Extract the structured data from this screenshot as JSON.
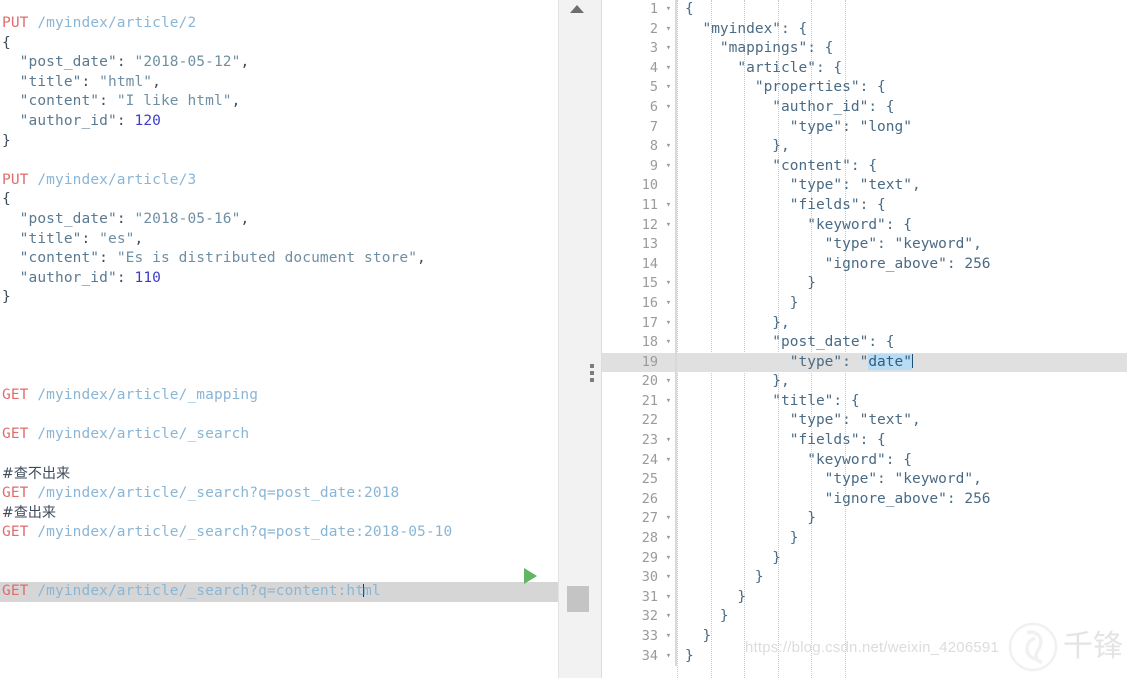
{
  "left_editor": {
    "name": "rest-request-editor",
    "lines": [
      {
        "type": "request",
        "verb": "PUT",
        "uri": "/myindex/article/2"
      },
      {
        "type": "plain",
        "text": "{"
      },
      {
        "type": "kv",
        "indent": 1,
        "key": "\"post_date\"",
        "value": "\"2018-05-12\"",
        "kind": "string",
        "comma": true
      },
      {
        "type": "kv",
        "indent": 1,
        "key": "\"title\"",
        "value": "\"html\"",
        "kind": "string",
        "comma": true
      },
      {
        "type": "kv",
        "indent": 1,
        "key": "\"content\"",
        "value": "\"I like html\"",
        "kind": "string",
        "comma": true
      },
      {
        "type": "kv",
        "indent": 1,
        "key": "\"author_id\"",
        "value": "120",
        "kind": "number",
        "comma": false
      },
      {
        "type": "plain",
        "text": "}"
      },
      {
        "type": "blank"
      },
      {
        "type": "request",
        "verb": "PUT",
        "uri": "/myindex/article/3"
      },
      {
        "type": "plain",
        "text": "{"
      },
      {
        "type": "kv",
        "indent": 1,
        "key": "\"post_date\"",
        "value": "\"2018-05-16\"",
        "kind": "string",
        "comma": true
      },
      {
        "type": "kv",
        "indent": 1,
        "key": "\"title\"",
        "value": "\"es\"",
        "kind": "string",
        "comma": true
      },
      {
        "type": "kv",
        "indent": 1,
        "key": "\"content\"",
        "value": "\"Es is distributed document store\"",
        "kind": "string",
        "comma": true
      },
      {
        "type": "kv",
        "indent": 1,
        "key": "\"author_id\"",
        "value": "110",
        "kind": "number",
        "comma": false
      },
      {
        "type": "plain",
        "text": "}"
      },
      {
        "type": "blank"
      },
      {
        "type": "blank"
      },
      {
        "type": "blank"
      },
      {
        "type": "blank"
      },
      {
        "type": "request",
        "verb": "GET",
        "uri": "/myindex/article/_mapping"
      },
      {
        "type": "blank"
      },
      {
        "type": "request",
        "verb": "GET",
        "uri": "/myindex/article/_search"
      },
      {
        "type": "blank"
      },
      {
        "type": "comment",
        "text": "#查不出来"
      },
      {
        "type": "request",
        "verb": "GET",
        "uri": "/myindex/article/_search?q=post_date:2018"
      },
      {
        "type": "comment",
        "text": "#查出来"
      },
      {
        "type": "request",
        "verb": "GET",
        "uri": "/myindex/article/_search?q=post_date:2018-05-10"
      },
      {
        "type": "blank"
      },
      {
        "type": "blank"
      },
      {
        "type": "request",
        "verb": "GET",
        "uri": "/myindex/article/_search?q=content:html",
        "active": true,
        "caret_after": "content:ht"
      }
    ],
    "run_button_label": "run-request",
    "wrench_button_label": "settings-wrench"
  },
  "splitter": {
    "scroll_up_label": "scroll-up",
    "handle_label": "pane-splitter"
  },
  "right_editor": {
    "name": "json-response-viewer",
    "current_line": 19,
    "selection_text": "date",
    "lines": [
      {
        "n": 1,
        "fold": true,
        "text": "{"
      },
      {
        "n": 2,
        "fold": true,
        "text": "  \"myindex\": {"
      },
      {
        "n": 3,
        "fold": true,
        "text": "    \"mappings\": {"
      },
      {
        "n": 4,
        "fold": true,
        "text": "      \"article\": {"
      },
      {
        "n": 5,
        "fold": true,
        "text": "        \"properties\": {"
      },
      {
        "n": 6,
        "fold": true,
        "text": "          \"author_id\": {"
      },
      {
        "n": 7,
        "fold": false,
        "text": "            \"type\": \"long\""
      },
      {
        "n": 8,
        "fold": true,
        "text": "          },"
      },
      {
        "n": 9,
        "fold": true,
        "text": "          \"content\": {"
      },
      {
        "n": 10,
        "fold": false,
        "text": "            \"type\": \"text\","
      },
      {
        "n": 11,
        "fold": true,
        "text": "            \"fields\": {"
      },
      {
        "n": 12,
        "fold": true,
        "text": "              \"keyword\": {"
      },
      {
        "n": 13,
        "fold": false,
        "text": "                \"type\": \"keyword\","
      },
      {
        "n": 14,
        "fold": false,
        "text": "                \"ignore_above\": 256"
      },
      {
        "n": 15,
        "fold": true,
        "text": "              }"
      },
      {
        "n": 16,
        "fold": true,
        "text": "            }"
      },
      {
        "n": 17,
        "fold": true,
        "text": "          },"
      },
      {
        "n": 18,
        "fold": true,
        "text": "          \"post_date\": {"
      },
      {
        "n": 19,
        "fold": false,
        "text": "            \"type\": \"date\"",
        "current": true,
        "select_from": 21,
        "select_len": 6
      },
      {
        "n": 20,
        "fold": true,
        "text": "          },"
      },
      {
        "n": 21,
        "fold": true,
        "text": "          \"title\": {"
      },
      {
        "n": 22,
        "fold": false,
        "text": "            \"type\": \"text\","
      },
      {
        "n": 23,
        "fold": true,
        "text": "            \"fields\": {"
      },
      {
        "n": 24,
        "fold": true,
        "text": "              \"keyword\": {"
      },
      {
        "n": 25,
        "fold": false,
        "text": "                \"type\": \"keyword\","
      },
      {
        "n": 26,
        "fold": false,
        "text": "                \"ignore_above\": 256"
      },
      {
        "n": 27,
        "fold": true,
        "text": "              }"
      },
      {
        "n": 28,
        "fold": true,
        "text": "            }"
      },
      {
        "n": 29,
        "fold": true,
        "text": "          }"
      },
      {
        "n": 30,
        "fold": true,
        "text": "        }"
      },
      {
        "n": 31,
        "fold": true,
        "text": "      }"
      },
      {
        "n": 32,
        "fold": true,
        "text": "    }"
      },
      {
        "n": 33,
        "fold": true,
        "text": "  }"
      },
      {
        "n": 34,
        "fold": true,
        "text": "}"
      }
    ]
  },
  "watermark": {
    "url": "https://blog.csdn.net/weixin_4206591",
    "brand_cn": "千锋"
  },
  "colors": {
    "verb": "#e06c6c",
    "uri": "#8ab6d6",
    "json_key": "#4a6b85",
    "number": "#3c3cc8",
    "active_row_bg": "#d6d6d6",
    "current_line_bg": "#e0e0e0",
    "selection_bg": "#b9dcf5",
    "run_green": "#62b562"
  }
}
